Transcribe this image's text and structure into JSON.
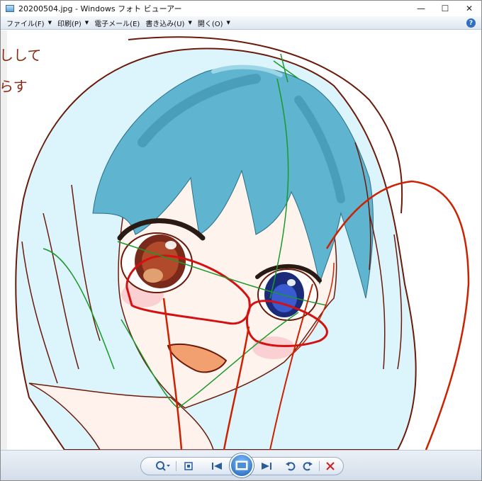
{
  "window": {
    "title": "20200504.jpg - Windows フォト ビューアー"
  },
  "window_buttons": {
    "minimize": "—",
    "maximize": "☐",
    "close": "✕"
  },
  "menu": {
    "file": "ファイル(F)",
    "print": "印刷(P)",
    "email": "電子メール(E)",
    "burn": "書き込み(U)",
    "open": "開く(O)"
  },
  "help": "?",
  "image_text": {
    "line1": "しして",
    "line2": "らす"
  },
  "colors": {
    "hair": "#5fb4cf",
    "hair_light": "#dcf4fb",
    "line": "#6b1a0a",
    "guide_green": "#1a9a2a",
    "guide_red": "#cc2200",
    "glasses": "#d41010"
  },
  "controls": {
    "zoom": "zoom-icon",
    "fit": "fit-window-icon",
    "previous": "previous-icon",
    "slideshow": "slideshow-icon",
    "next": "next-icon",
    "rotate_left": "rotate-counterclockwise-icon",
    "rotate_right": "rotate-clockwise-icon",
    "delete": "delete-icon"
  }
}
